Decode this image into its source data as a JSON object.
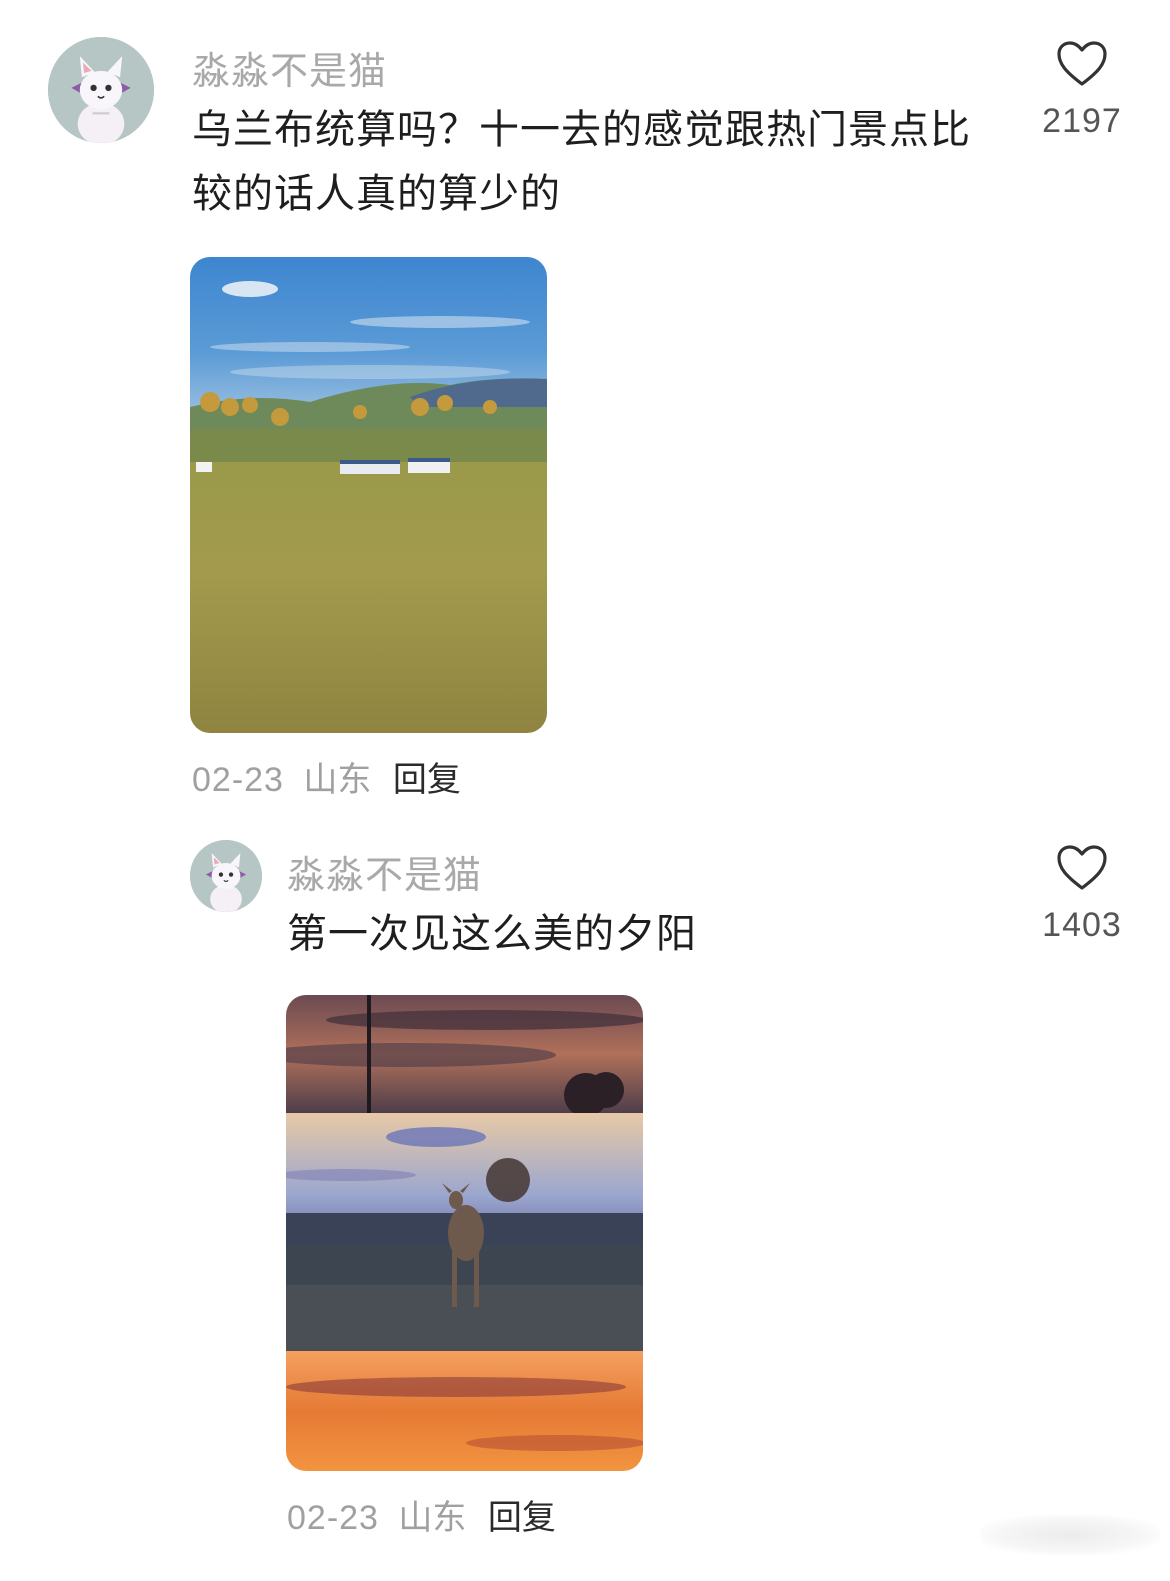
{
  "comments": [
    {
      "username": "淼淼不是猫",
      "text_line1": "乌兰布统算吗？十一去的感觉跟热门景点比",
      "text_line2": "较的话人真的算少的",
      "like_count": "2197",
      "date": "02-23",
      "location": "山东",
      "reply_label": "回复",
      "avatar_icon": "cartoon-cat-avatar",
      "photo": "grassland-landscape-photo"
    },
    {
      "username": "淼淼不是猫",
      "text_line1": "第一次见这么美的夕阳",
      "like_count": "1403",
      "date": "02-23",
      "location": "山东",
      "reply_label": "回复",
      "avatar_icon": "cartoon-cat-avatar",
      "photo": "sunset-deer-collage-photo"
    }
  ],
  "colors": {
    "username": "#a9a9a9",
    "meta": "#a0a0a0",
    "text": "#1e1e1e"
  },
  "icons": {
    "like": "heart-outline-icon"
  }
}
